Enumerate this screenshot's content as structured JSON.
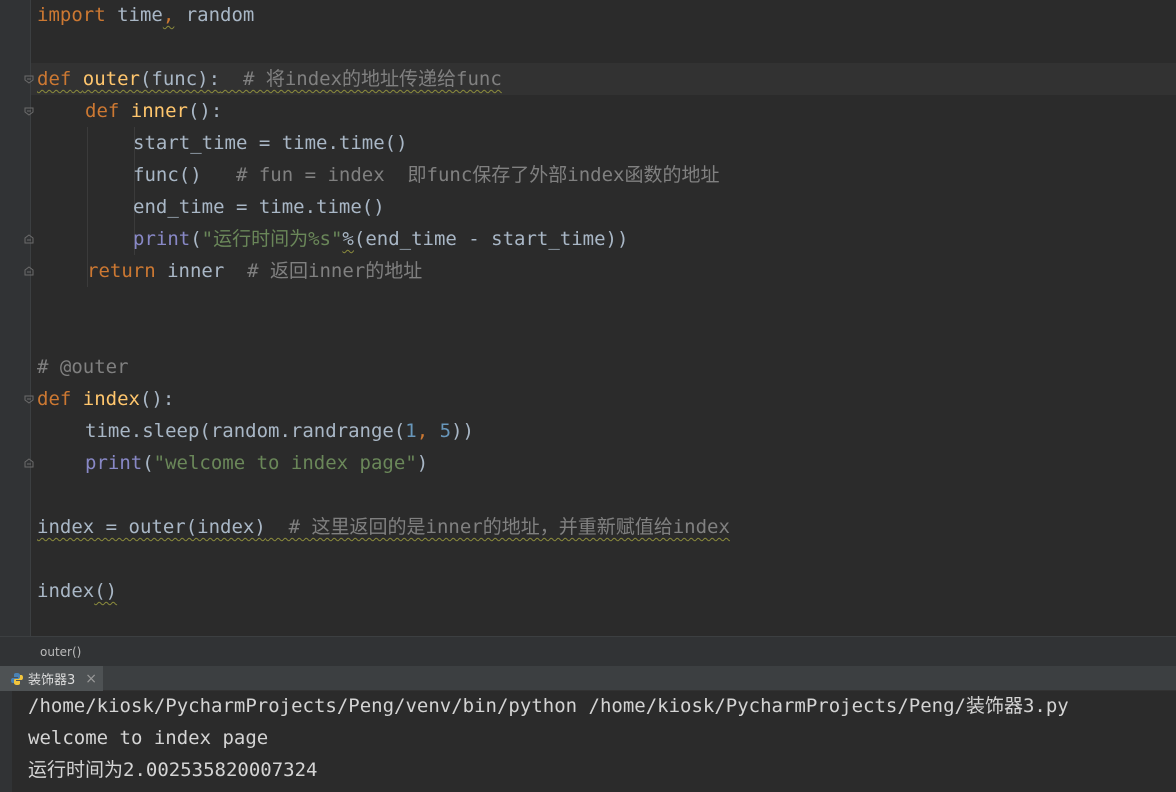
{
  "code": {
    "l1": {
      "import": "import",
      "rest1": " time",
      "comma": ",",
      "rest2": " random"
    },
    "l3": {
      "def": "def",
      "name": "outer",
      "args": "(func):",
      "comment": "  # 将index的地址传递给func"
    },
    "l4": {
      "def": "def",
      "name": "inner",
      "args": "():"
    },
    "l5": {
      "text": "start_time = time.time()"
    },
    "l6": {
      "text": "func()",
      "comment": "   # fun = index  即func保存了外部index函数的地址"
    },
    "l7": {
      "text": "end_time = time.time()"
    },
    "l8": {
      "print": "print",
      "open": "(",
      "str": "\"运行时间为%s\"",
      "pct": "%",
      "rest": "(end_time - start_time))"
    },
    "l9": {
      "return": "return",
      "rest": " inner",
      "comment": "  # 返回inner的地址"
    },
    "l12": {
      "comment": "# @outer"
    },
    "l13": {
      "def": "def",
      "name": "index",
      "args": "():"
    },
    "l14": {
      "pre": "time.sleep(random.randrange(",
      "n1": "1",
      "mid": ", ",
      "n2": "5",
      "post": "))"
    },
    "l15": {
      "print": "print",
      "open": "(",
      "str": "\"welcome to index page\"",
      "close": ")"
    },
    "l17": {
      "text": "index = outer(index)",
      "comment": "  # 这里返回的是inner的地址，并重新赋值给index"
    },
    "l19": {
      "text": "index",
      "paren": "()"
    }
  },
  "breadcrumb": {
    "label": "outer()"
  },
  "run_tab": {
    "label": "装饰器3",
    "close": "×"
  },
  "console": {
    "lines": [
      "/home/kiosk/PycharmProjects/Peng/venv/bin/python /home/kiosk/PycharmProjects/Peng/装饰器3.py",
      "welcome to index page",
      "运行时间为2.002535820007324"
    ]
  },
  "colors": {
    "background": "#2b2b2b",
    "keyword": "#cc7832",
    "function": "#ffc66d",
    "builtin": "#8888c6",
    "string": "#6a8759",
    "number": "#6897bb",
    "comment": "#808080"
  }
}
